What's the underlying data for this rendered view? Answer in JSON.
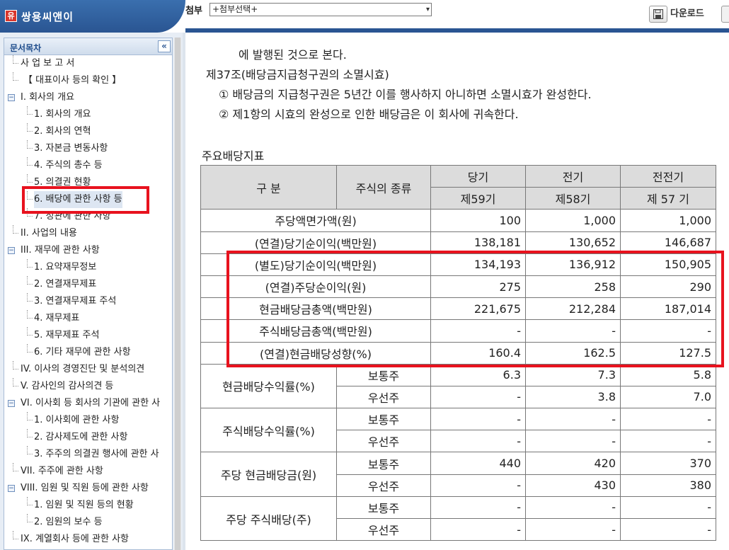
{
  "header": {
    "brand_logo": "유",
    "brand_name": "쌍용씨앤이",
    "attach_label": "첨부",
    "attach_select": "+첨부선택+",
    "download_label": "다운로드"
  },
  "sidebar": {
    "title": "문서목차",
    "collapse_glyph": "«",
    "items": [
      {
        "label": "사 업 보 고 서",
        "level": 0,
        "toggle": ""
      },
      {
        "label": "【 대표이사 등의 확인 】",
        "level": 1,
        "toggle": ""
      },
      {
        "label": "I. 회사의 개요",
        "level": 0,
        "toggle": "−"
      },
      {
        "label": "1. 회사의 개요",
        "level": 2,
        "toggle": ""
      },
      {
        "label": "2. 회사의 연혁",
        "level": 2,
        "toggle": ""
      },
      {
        "label": "3. 자본금 변동사항",
        "level": 2,
        "toggle": ""
      },
      {
        "label": "4. 주식의 총수 등",
        "level": 2,
        "toggle": ""
      },
      {
        "label": "5. 의결권 현황",
        "level": 2,
        "toggle": ""
      },
      {
        "label": "6. 배당에 관한 사항 등",
        "level": 2,
        "toggle": "",
        "selected": true
      },
      {
        "label": "7. 정관에 관한 사항",
        "level": 2,
        "toggle": ""
      },
      {
        "label": "II. 사업의 내용",
        "level": 0,
        "toggle": ""
      },
      {
        "label": "III. 재무에 관한 사항",
        "level": 0,
        "toggle": "−"
      },
      {
        "label": "1. 요약재무정보",
        "level": 2,
        "toggle": ""
      },
      {
        "label": "2. 연결재무제표",
        "level": 2,
        "toggle": ""
      },
      {
        "label": "3. 연결재무제표 주석",
        "level": 2,
        "toggle": ""
      },
      {
        "label": "4. 재무제표",
        "level": 2,
        "toggle": ""
      },
      {
        "label": "5. 재무제표 주석",
        "level": 2,
        "toggle": ""
      },
      {
        "label": "6. 기타 재무에 관한 사항",
        "level": 2,
        "toggle": ""
      },
      {
        "label": "IV. 이사의 경영진단 및 분석의견",
        "level": 0,
        "toggle": ""
      },
      {
        "label": "V. 감사인의 감사의견 등",
        "level": 0,
        "toggle": ""
      },
      {
        "label": "VI. 이사회 등 회사의 기관에 관한 사",
        "level": 0,
        "toggle": "−"
      },
      {
        "label": "1. 이사회에 관한 사항",
        "level": 2,
        "toggle": ""
      },
      {
        "label": "2. 감사제도에 관한 사항",
        "level": 2,
        "toggle": ""
      },
      {
        "label": "3. 주주의 의결권 행사에 관한 사",
        "level": 2,
        "toggle": ""
      },
      {
        "label": "VII. 주주에 관한 사항",
        "level": 0,
        "toggle": ""
      },
      {
        "label": "VIII. 임원 및 직원 등에 관한 사항",
        "level": 0,
        "toggle": "−"
      },
      {
        "label": "1. 임원 및 직원 등의 현황",
        "level": 2,
        "toggle": ""
      },
      {
        "label": "2. 임원의 보수 등",
        "level": 2,
        "toggle": ""
      },
      {
        "label": "IX. 계열회사 등에 관한 사항",
        "level": 0,
        "toggle": ""
      }
    ]
  },
  "document": {
    "lines": [
      "에 발행된 것으로 본다.",
      "제37조(배당금지급청구권의 소멸시효)",
      "① 배당금의 지급청구권은 5년간 이를 행사하지 아니하면 소멸시효가 완성한다.",
      "② 제1항의 시효의 완성으로 인한 배당금은 이 회사에 귀속한다."
    ],
    "table_title": "주요배당지표",
    "table": {
      "header": {
        "col_item": "구  분",
        "col_stock_type": "주식의 종류",
        "periods": [
          "당기",
          "전기",
          "전전기"
        ],
        "period_numbers": [
          "제59기",
          "제58기",
          "제 57 기"
        ]
      },
      "rows": [
        {
          "item": "주당액면가액(원)",
          "stock_type": "",
          "values": [
            "100",
            "1,000",
            "1,000"
          ]
        },
        {
          "item": "(연결)당기순이익(백만원)",
          "stock_type": "",
          "values": [
            "138,181",
            "130,652",
            "146,687"
          ]
        },
        {
          "item": "(별도)당기순이익(백만원)",
          "stock_type": "",
          "values": [
            "134,193",
            "136,912",
            "150,905"
          ]
        },
        {
          "item": "(연결)주당순이익(원)",
          "stock_type": "",
          "values": [
            "275",
            "258",
            "290"
          ]
        },
        {
          "item": "현금배당금총액(백만원)",
          "stock_type": "",
          "values": [
            "221,675",
            "212,284",
            "187,014"
          ]
        },
        {
          "item": "주식배당금총액(백만원)",
          "stock_type": "",
          "values": [
            "-",
            "-",
            "-"
          ]
        },
        {
          "item": "(연결)현금배당성향(%)",
          "stock_type": "",
          "values": [
            "160.4",
            "162.5",
            "127.5"
          ]
        },
        {
          "item": "현금배당수익률(%)",
          "stock_type": "보통주",
          "values": [
            "6.3",
            "7.3",
            "5.8"
          ]
        },
        {
          "item": "",
          "stock_type": "우선주",
          "values": [
            "-",
            "3.8",
            "7.0"
          ]
        },
        {
          "item": "주식배당수익률(%)",
          "stock_type": "보통주",
          "values": [
            "-",
            "-",
            "-"
          ]
        },
        {
          "item": "",
          "stock_type": "우선주",
          "values": [
            "-",
            "-",
            "-"
          ]
        },
        {
          "item": "주당 현금배당금(원)",
          "stock_type": "보통주",
          "values": [
            "440",
            "420",
            "370"
          ]
        },
        {
          "item": "",
          "stock_type": "우선주",
          "values": [
            "-",
            "430",
            "380"
          ]
        },
        {
          "item": "주당 주식배당(주)",
          "stock_type": "보통주",
          "values": [
            "-",
            "-",
            "-"
          ]
        },
        {
          "item": "",
          "stock_type": "우선주",
          "values": [
            "-",
            "-",
            "-"
          ]
        }
      ]
    }
  },
  "colors": {
    "header_blue": "#2a5592",
    "highlight_red": "#e8121e",
    "table_header_gray": "#dcdcdc"
  }
}
